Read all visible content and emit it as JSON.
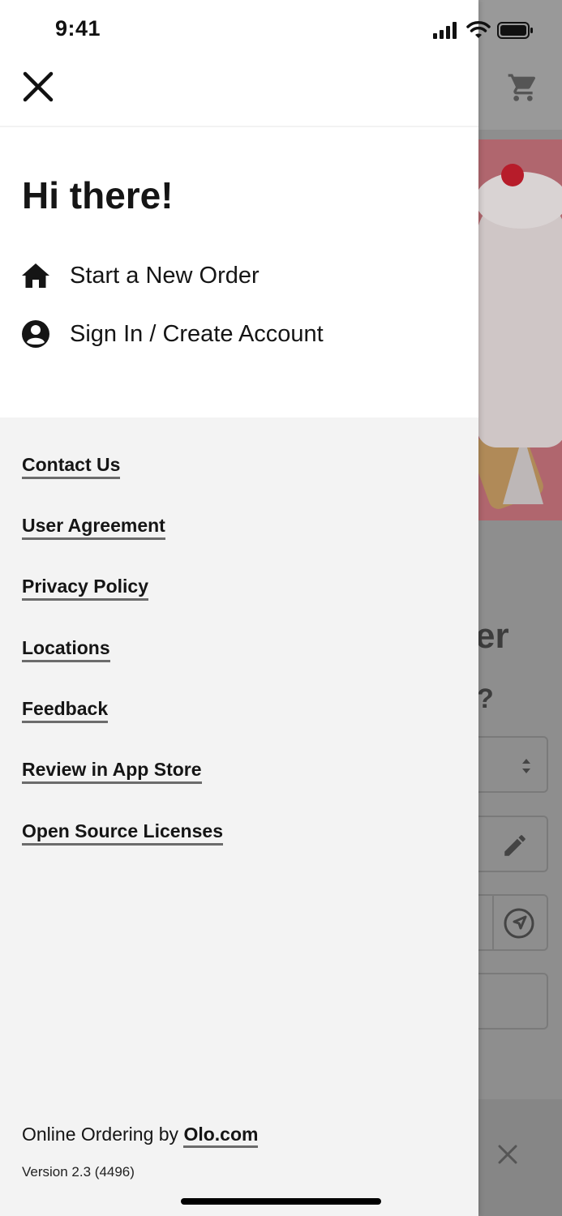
{
  "status_bar": {
    "time": "9:41"
  },
  "drawer": {
    "greeting": "Hi there!",
    "menu": [
      {
        "label": "Start a New Order",
        "icon": "home-icon"
      },
      {
        "label": "Sign In / Create Account",
        "icon": "account-icon"
      }
    ],
    "links": [
      "Contact Us",
      "User Agreement",
      "Privacy Policy",
      "Locations",
      "Feedback",
      "Review in App Store",
      "Open Source Licenses"
    ],
    "footer": {
      "powered_prefix": "Online Ordering by ",
      "powered_link": "Olo.com",
      "version": "Version 2.3 (4496)"
    }
  },
  "background_page": {
    "partial_heading": "er",
    "partial_question": "?"
  },
  "colors": {
    "drawer_bg": "#f3f3f3",
    "drawer_top_bg": "#ffffff",
    "text": "#151515",
    "link_underline": "#6b6b6b",
    "overlay": "#8e8e8e"
  }
}
